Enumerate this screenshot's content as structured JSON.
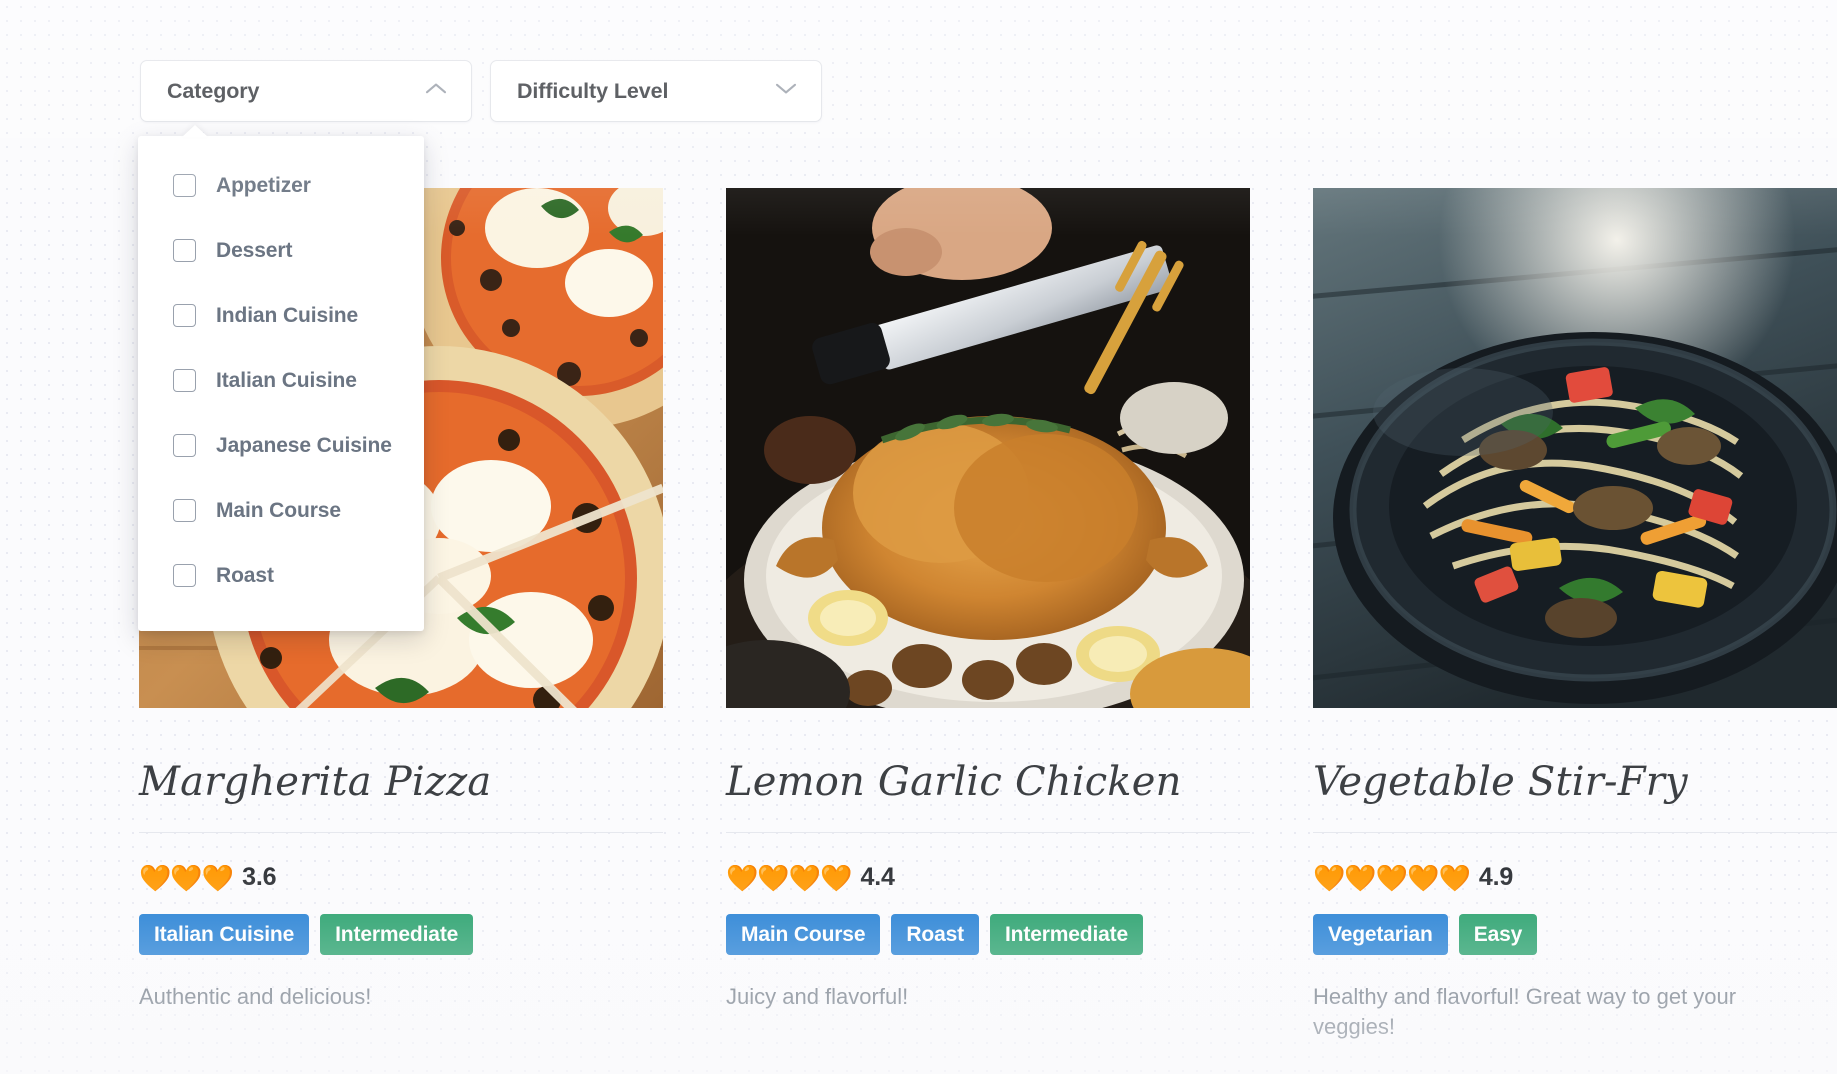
{
  "filters": [
    {
      "name": "category",
      "label": "Category",
      "expanded": true,
      "chevron": "chevron-up-icon",
      "options": [
        {
          "label": "Appetizer",
          "checked": false
        },
        {
          "label": "Dessert",
          "checked": false
        },
        {
          "label": "Indian Cuisine",
          "checked": false
        },
        {
          "label": "Italian Cuisine",
          "checked": false
        },
        {
          "label": "Japanese Cuisine",
          "checked": false
        },
        {
          "label": "Main Course",
          "checked": false
        },
        {
          "label": "Roast",
          "checked": false
        }
      ]
    },
    {
      "name": "difficulty",
      "label": "Difficulty Level",
      "expanded": false,
      "chevron": "chevron-down-icon",
      "options": []
    }
  ],
  "recipes": [
    {
      "title": "Margherita Pizza",
      "image_alt": "margherita-pizza-photo",
      "rating": "3.6",
      "hearts": "🧡🧡🧡",
      "heart_count": 3,
      "category_tags": [
        "Italian Cuisine"
      ],
      "difficulty_tag": "Intermediate",
      "description": "Authentic and delicious!"
    },
    {
      "title": "Lemon Garlic Chicken",
      "image_alt": "lemon-garlic-chicken-photo",
      "rating": "4.4",
      "hearts": "🧡🧡🧡🧡",
      "heart_count": 4,
      "category_tags": [
        "Main Course",
        "Roast"
      ],
      "difficulty_tag": "Intermediate",
      "description": "Juicy and flavorful!"
    },
    {
      "title": "Vegetable Stir-Fry",
      "image_alt": "vegetable-stir-fry-photo",
      "rating": "4.9",
      "hearts": "🧡🧡🧡🧡🧡",
      "heart_count": 5,
      "category_tags": [
        "Vegetarian"
      ],
      "difficulty_tag": "Easy",
      "description": "Healthy and flavorful! Great way to get your veggies!"
    }
  ],
  "colors": {
    "category_tag": "#1879d2",
    "difficulty_tag": "#1a9b63",
    "heart": "#f79219",
    "page_background": "#fbfbfd",
    "dot_grid": "#e3e5ef"
  }
}
